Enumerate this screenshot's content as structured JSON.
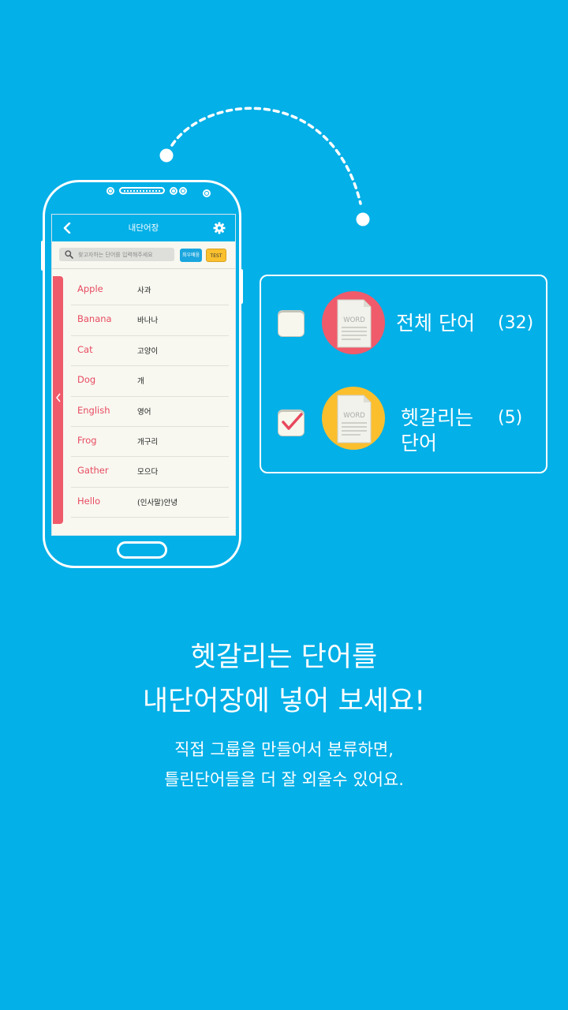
{
  "colors": {
    "background": "#03b0e8",
    "accent_red": "#ef5b6b",
    "accent_yellow": "#fbbf2e",
    "word_english": "#e84a5f"
  },
  "app": {
    "title": "내단어장",
    "back_icon": "chevron-left-icon",
    "settings_icon": "gear-icon",
    "search_placeholder": "찾고자하는 단어를 입력해주세요",
    "buttons": {
      "recent": "최우배움",
      "test": "TEST"
    },
    "words": [
      {
        "en": "Apple",
        "ko": "사과"
      },
      {
        "en": "Banana",
        "ko": "바나나"
      },
      {
        "en": "Cat",
        "ko": "고양이"
      },
      {
        "en": "Dog",
        "ko": "개"
      },
      {
        "en": "English",
        "ko": "영어"
      },
      {
        "en": "Frog",
        "ko": "개구리"
      },
      {
        "en": "Gather",
        "ko": "모으다"
      },
      {
        "en": "Hello",
        "ko": "(인사말)안녕"
      }
    ]
  },
  "options": [
    {
      "label": "전체 단어",
      "count": "(32)",
      "checked": false,
      "doc_text": "WORD"
    },
    {
      "label_line1": "헷갈리는",
      "label_line2": "단어",
      "count": "(5)",
      "checked": true,
      "doc_text": "WORD"
    }
  ],
  "headline": {
    "line1": "헷갈리는 단어를",
    "line2": "내단어장에 넣어 보세요!"
  },
  "subtext": {
    "line1": "직접 그룹을 만들어서 분류하면,",
    "line2": "틀린단어들을 더 잘 외울수 있어요."
  }
}
